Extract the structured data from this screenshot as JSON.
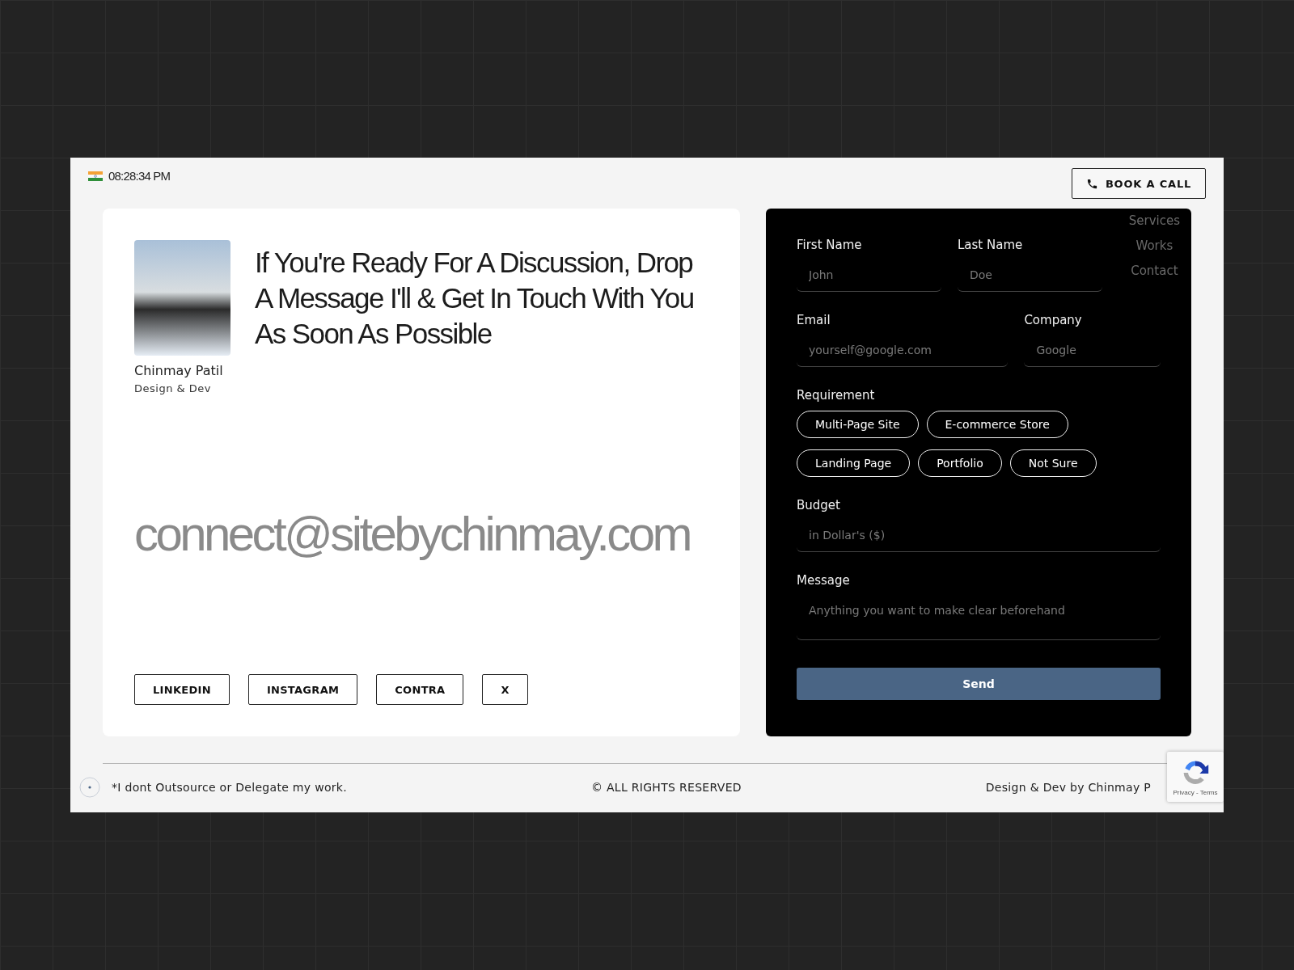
{
  "header": {
    "time": "08:28:34 PM",
    "book_call": {
      "label": "BOOK A CALL"
    }
  },
  "profile": {
    "name": "Chinmay Patil",
    "role": "Design & Dev"
  },
  "headline": "If You're Ready For A Discussion, Drop A Message I'll & Get In Touch With You As Soon As Possible",
  "email": "connect@sitebychinmay.com",
  "social_links": [
    "LINKEDIN",
    "INSTAGRAM",
    "CONTRA",
    "X"
  ],
  "nav_links": [
    "Services",
    "Works",
    "Contact"
  ],
  "form": {
    "rows": [
      [
        {
          "label": "First Name",
          "placeholder": "John"
        },
        {
          "label": "Last Name",
          "placeholder": "Doe"
        }
      ],
      [
        {
          "label": "Email",
          "placeholder": "yourself@google.com"
        },
        {
          "label": "Company",
          "placeholder": "Google"
        }
      ]
    ],
    "requirement": {
      "label": "Requirement",
      "options": [
        {
          "label": "Multi-Page Site",
          "selected": false
        },
        {
          "label": "E-commerce Store",
          "selected": false
        },
        {
          "label": "Landing Page",
          "selected": false
        },
        {
          "label": "Portfolio",
          "selected": false
        },
        {
          "label": "Not Sure",
          "selected": false
        }
      ]
    },
    "budget": {
      "label": "Budget",
      "placeholder": "in Dollar's ($)"
    },
    "message": {
      "label": "Message",
      "placeholder": "Anything you want to make clear beforehand"
    },
    "send": "Send"
  },
  "footer": {
    "note": "*I dont Outsource or Delegate my work.",
    "copyright": "© ALL RIGHTS RESERVED",
    "credit": "Design & Dev by Chinmay P"
  },
  "recaptcha": {
    "links": "Privacy - Terms"
  }
}
